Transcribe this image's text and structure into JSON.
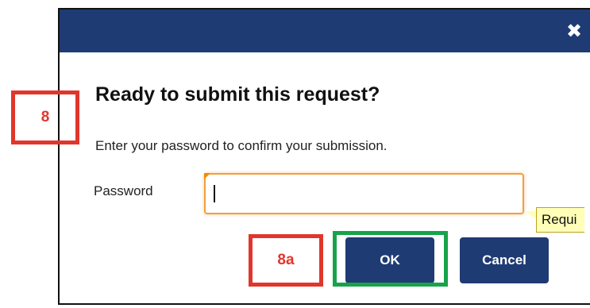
{
  "dialog": {
    "close_glyph": "✖",
    "heading": "Ready to submit this request?",
    "instructions": "Enter your password to confirm your submission.",
    "password_label": "Password",
    "password_value": "",
    "tooltip_text": "Requi",
    "ok_label": "OK",
    "cancel_label": "Cancel"
  },
  "callouts": {
    "step_8": "8",
    "step_8a": "8a"
  },
  "colors": {
    "titlebar": "#1f3b73",
    "button": "#1f3b73",
    "callout_red": "#e0362c",
    "callout_green": "#16a34a",
    "input_focus": "#f0a040",
    "tooltip_bg": "#ffffb8"
  },
  "icons": {
    "close": "close-icon",
    "required_marker": "required-corner-icon"
  }
}
